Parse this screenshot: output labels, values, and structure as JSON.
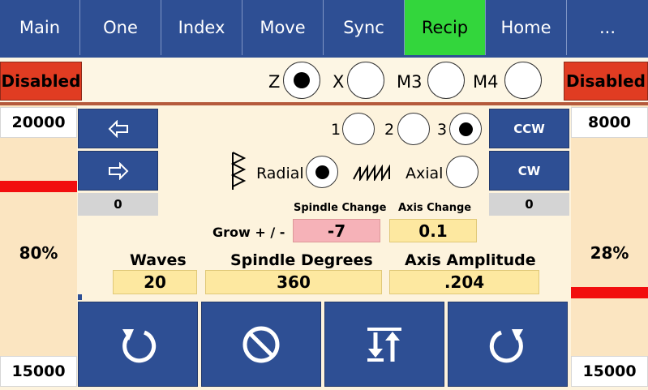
{
  "tabs": [
    {
      "label": "Main",
      "active": false
    },
    {
      "label": "One",
      "active": false
    },
    {
      "label": "Index",
      "active": false
    },
    {
      "label": "Move",
      "active": false
    },
    {
      "label": "Sync",
      "active": false
    },
    {
      "label": "Recip",
      "active": true
    },
    {
      "label": "Home",
      "active": false
    },
    {
      "label": "...",
      "active": false
    }
  ],
  "status": {
    "left": "Disabled",
    "right": "Disabled"
  },
  "axes": [
    {
      "label": "Z",
      "selected": true
    },
    {
      "label": "X",
      "selected": false
    },
    {
      "label": "M3",
      "selected": false
    },
    {
      "label": "M4",
      "selected": false
    }
  ],
  "left_slider": {
    "max": "20000",
    "min": "15000",
    "percent_label": "80%",
    "level": 0.8
  },
  "right_slider": {
    "max": "8000",
    "min": "15000",
    "percent_label": "28%",
    "level": 0.28
  },
  "left_controls": {
    "left_arrow_icon": "left-arrow-icon",
    "right_arrow_icon": "right-arrow-icon",
    "value": "0"
  },
  "right_controls": {
    "ccw_label": "CCW",
    "cw_label": "CW",
    "value": "0"
  },
  "numbers": [
    {
      "label": "1",
      "selected": false
    },
    {
      "label": "2",
      "selected": false
    },
    {
      "label": "3",
      "selected": true
    }
  ],
  "modes": {
    "radial_label": "Radial",
    "radial_selected": true,
    "axial_label": "Axial",
    "axial_selected": false
  },
  "grow": {
    "label": "Grow + / -",
    "spindle_change_label": "Spindle Change",
    "spindle_change_value": "-7",
    "axis_change_label": "Axis Change",
    "axis_change_value": "0.1"
  },
  "params": {
    "waves_label": "Waves",
    "waves_value": "20",
    "spindle_degrees_label": "Spindle Degrees",
    "spindle_degrees_value": "360",
    "axis_amplitude_label": "Axis Amplitude",
    "axis_amplitude_value": ".204"
  },
  "bottom_buttons": [
    {
      "name": "rotate-ccw-button",
      "icon": "rotate-ccw-icon"
    },
    {
      "name": "stop-button",
      "icon": "cancel-icon"
    },
    {
      "name": "sync-direction-button",
      "icon": "up-down-arrows-icon"
    },
    {
      "name": "rotate-cw-button",
      "icon": "rotate-cw-icon"
    }
  ],
  "colors": {
    "tab_blue": "#2e4f94",
    "active_green": "#33d63c",
    "disabled_red": "#e03c22",
    "field_yellow": "#fde8a0",
    "field_pink": "#f6b2b8",
    "bar_red": "#f20e0e"
  }
}
